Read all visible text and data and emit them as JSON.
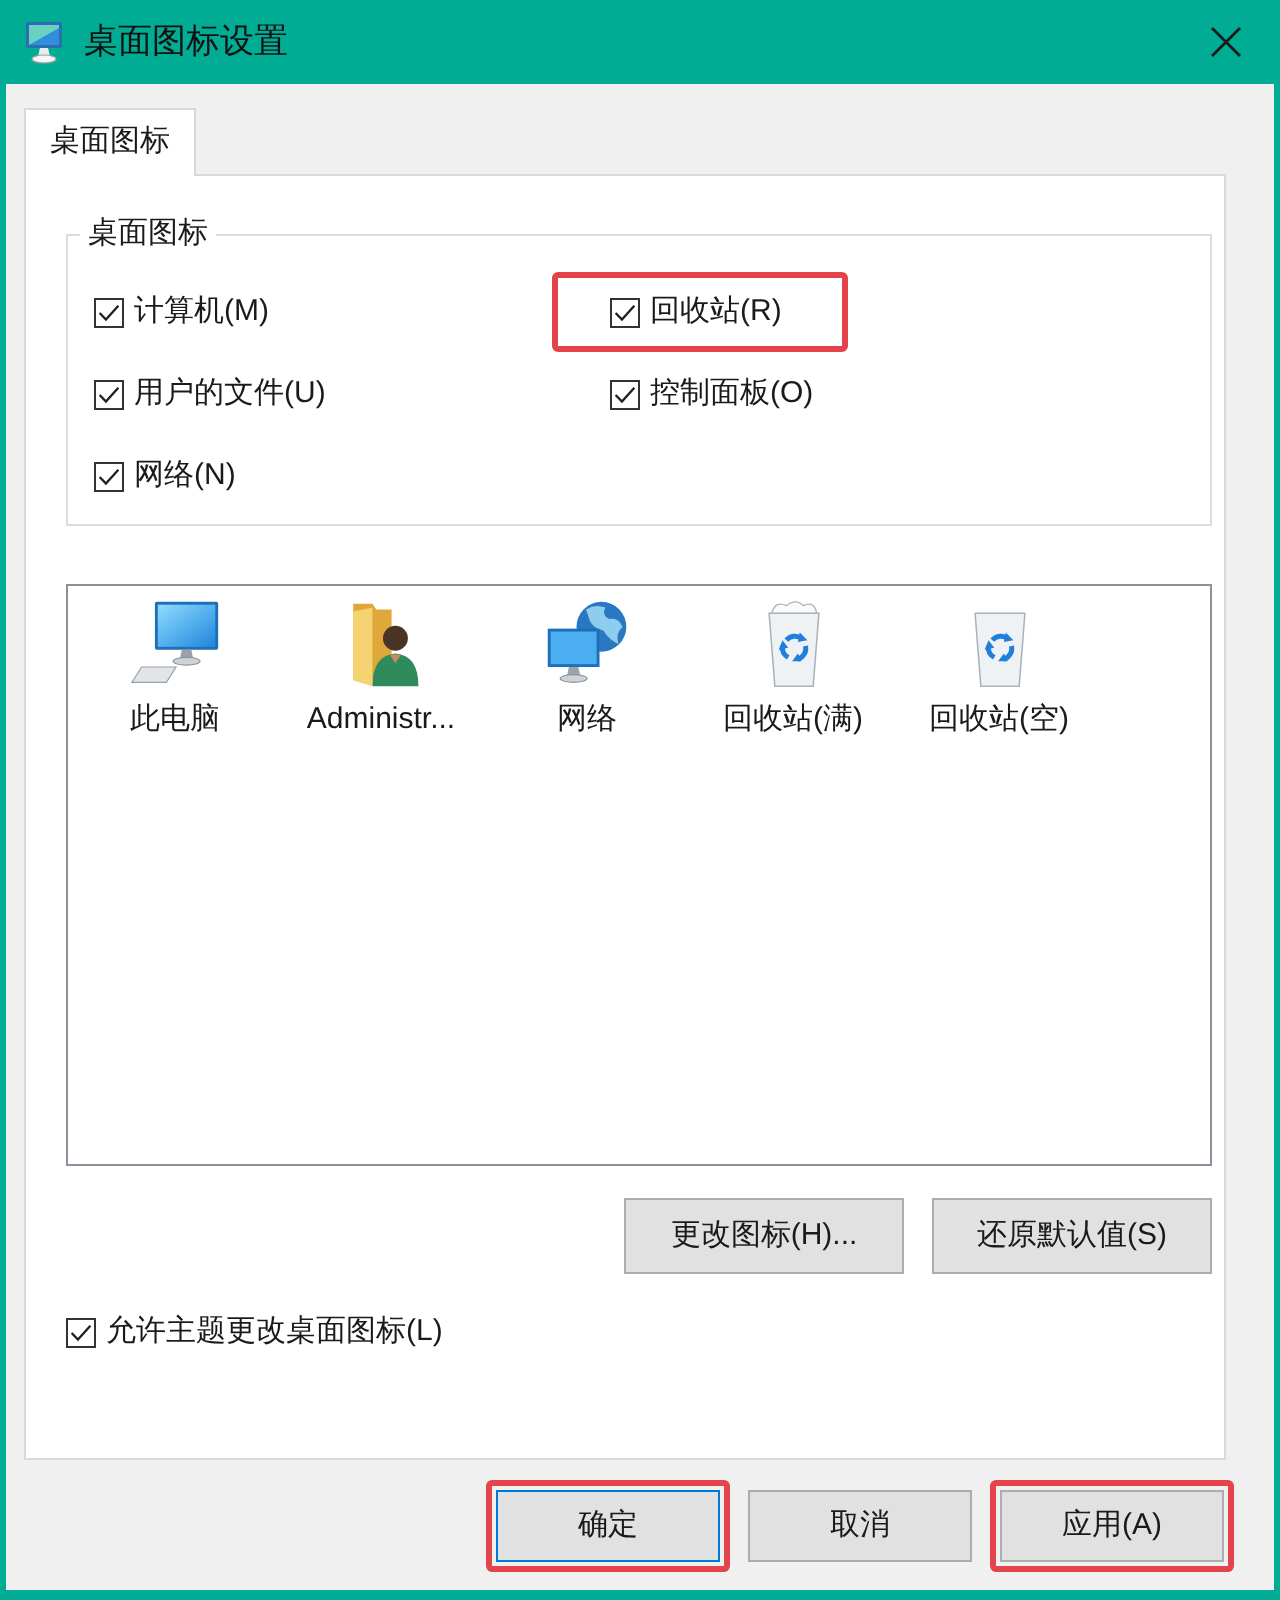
{
  "window": {
    "title": "桌面图标设置"
  },
  "tabs": [
    {
      "label": "桌面图标",
      "selected": true
    }
  ],
  "desktop_icons_group": {
    "title": "桌面图标",
    "checkboxes": [
      {
        "label": "计算机(M)",
        "checked": true,
        "highlighted": false
      },
      {
        "label": "回收站(R)",
        "checked": true,
        "highlighted": true
      },
      {
        "label": "用户的文件(U)",
        "checked": true,
        "highlighted": false
      },
      {
        "label": "控制面板(O)",
        "checked": true,
        "highlighted": false
      },
      {
        "label": "网络(N)",
        "checked": true,
        "highlighted": false
      }
    ]
  },
  "icon_list": [
    {
      "label": "此电脑",
      "kind": "computer"
    },
    {
      "label": "Administr...",
      "kind": "user_folder"
    },
    {
      "label": "网络",
      "kind": "network"
    },
    {
      "label": "回收站(满)",
      "kind": "recycle_bin_full"
    },
    {
      "label": "回收站(空)",
      "kind": "recycle_bin_empty"
    }
  ],
  "icon_buttons": [
    {
      "label": "更改图标(H)..."
    },
    {
      "label": "还原默认值(S)"
    }
  ],
  "allow_themes": {
    "label": "允许主题更改桌面图标(L)",
    "checked": true
  },
  "dialog_buttons": [
    {
      "label": "确定",
      "default": true,
      "highlighted": true
    },
    {
      "label": "取消",
      "default": false,
      "highlighted": false
    },
    {
      "label": "应用(A)",
      "default": false,
      "highlighted": true
    }
  ]
}
